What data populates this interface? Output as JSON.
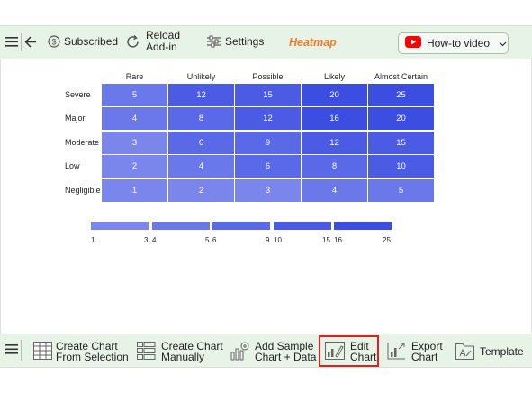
{
  "toolbar": {
    "subscribed_label": "Subscribed",
    "reload_line1": "Reload",
    "reload_line2": "Add-in",
    "settings_label": "Settings",
    "app_title": "Heatmap",
    "howto_label": "How-to video"
  },
  "chart_data": {
    "type": "heatmap",
    "columns": [
      "Rare",
      "Unlikely",
      "Possible",
      "Likely",
      "Almost Certain"
    ],
    "rows": [
      "Severe",
      "Major",
      "Moderate",
      "Low",
      "Negligible"
    ],
    "values": [
      [
        5,
        12,
        15,
        20,
        25
      ],
      [
        4,
        8,
        12,
        16,
        20
      ],
      [
        3,
        6,
        9,
        12,
        15
      ],
      [
        2,
        4,
        6,
        8,
        10
      ],
      [
        1,
        2,
        3,
        4,
        5
      ]
    ],
    "legend": [
      {
        "min": "1",
        "max": "3",
        "color": "#7b86ec"
      },
      {
        "min": "4",
        "max": "5",
        "color": "#6b78ea"
      },
      {
        "min": "6",
        "max": "9",
        "color": "#5a69e7"
      },
      {
        "min": "10",
        "max": "15",
        "color": "#4b5be4"
      },
      {
        "min": "16",
        "max": "25",
        "color": "#3c4de1"
      }
    ]
  },
  "bottombar": {
    "create_selection_line1": "Create Chart",
    "create_selection_line2": "From Selection",
    "create_manual_line1": "Create Chart",
    "create_manual_line2": "Manually",
    "sample_line1": "Add Sample",
    "sample_line2": "Chart + Data",
    "edit_line1": "Edit",
    "edit_line2": "Chart",
    "export_line1": "Export",
    "export_line2": "Chart",
    "template_label": "Template"
  },
  "colors": {
    "toolbar_bg": "#e8f3e8",
    "accent_orange": "#f07c2a",
    "highlight_red": "#e02020",
    "youtube_red": "#ff0000"
  }
}
